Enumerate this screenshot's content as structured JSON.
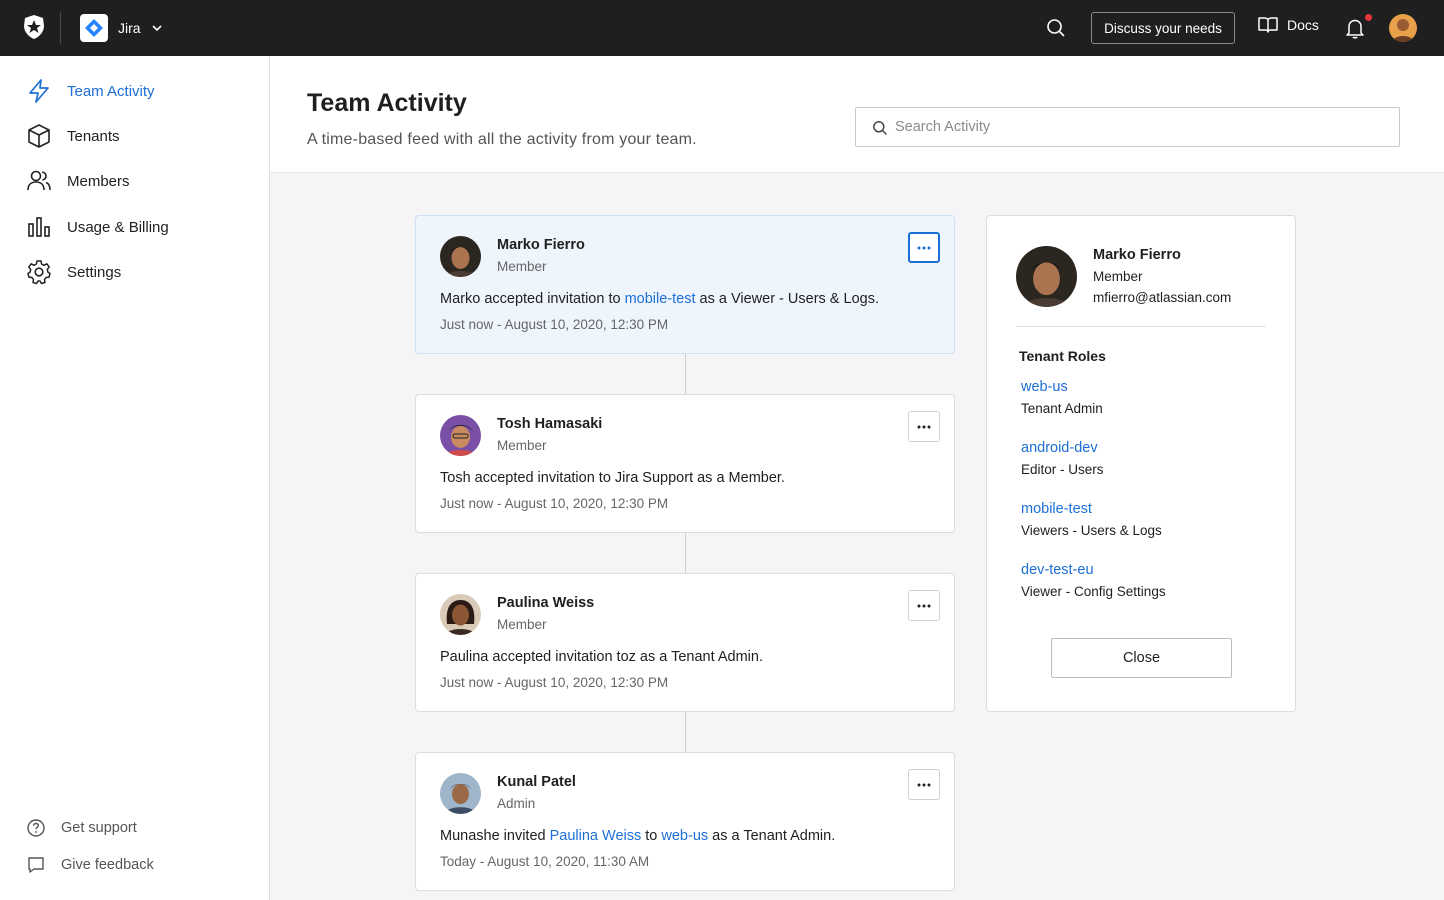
{
  "topbar": {
    "app_name": "Jira",
    "discuss_label": "Discuss your needs",
    "docs_label": "Docs",
    "notification_dot_color": "#e5373a"
  },
  "sidebar": {
    "items": [
      {
        "label": "Team Activity",
        "icon": "lightning-icon",
        "active": true
      },
      {
        "label": "Tenants",
        "icon": "cube-icon",
        "active": false
      },
      {
        "label": "Members",
        "icon": "users-icon",
        "active": false
      },
      {
        "label": "Usage & Billing",
        "icon": "bar-chart-icon",
        "active": false
      },
      {
        "label": "Settings",
        "icon": "gear-icon",
        "active": false
      }
    ],
    "footer": [
      {
        "label": "Get support",
        "icon": "help-icon"
      },
      {
        "label": "Give feedback",
        "icon": "chat-icon"
      }
    ]
  },
  "header": {
    "title": "Team Activity",
    "subtitle": "A time-based feed with all the activity from your team.",
    "search_placeholder": "Search Activity"
  },
  "feed": [
    {
      "name": "Marko Fierro",
      "role": "Member",
      "msg": {
        "p1": "Marko accepted invitation to ",
        "link1": "mobile-test",
        "p2": " as a ",
        "strong": "Viewer - Users & Logs",
        "p3": "."
      },
      "time": "Just now - August 10, 2020, 12:30 PM"
    },
    {
      "name": "Tosh Hamasaki",
      "role": "Member",
      "msg": {
        "p1": "Tosh accepted invitation to Jira Support as a Member."
      },
      "time": "Just now - August 10, 2020, 12:30 PM"
    },
    {
      "name": "Paulina Weiss",
      "role": "Member",
      "msg": {
        "p1": "Paulina accepted invitation toz as a Tenant Admin."
      },
      "time": "Just now - August 10, 2020, 12:30 PM"
    },
    {
      "name": "Kunal Patel",
      "role": "Admin",
      "msg": {
        "p1": "Munashe invited ",
        "link1": "Paulina Weiss",
        "p2": " to ",
        "link2": "web-us",
        "p3": " as a Tenant Admin."
      },
      "time": "Today - August 10, 2020, 11:30 AM"
    }
  ],
  "panel": {
    "name": "Marko Fierro",
    "role": "Member",
    "email": "mfierro@atlassian.com",
    "roles_title": "Tenant Roles",
    "tenants": [
      {
        "name": "web-us",
        "role": "Tenant Admin"
      },
      {
        "name": "android-dev",
        "role": "Editor - Users"
      },
      {
        "name": "mobile-test",
        "role": "Viewers - Users & Logs"
      },
      {
        "name": "dev-test-eu",
        "role": "Viewer - Config Settings"
      }
    ],
    "close_label": "Close"
  },
  "colors": {
    "accent": "#1d6fd6",
    "topbar_bg": "#1f1f1f",
    "highlight_card_bg": "#eef5fd"
  }
}
